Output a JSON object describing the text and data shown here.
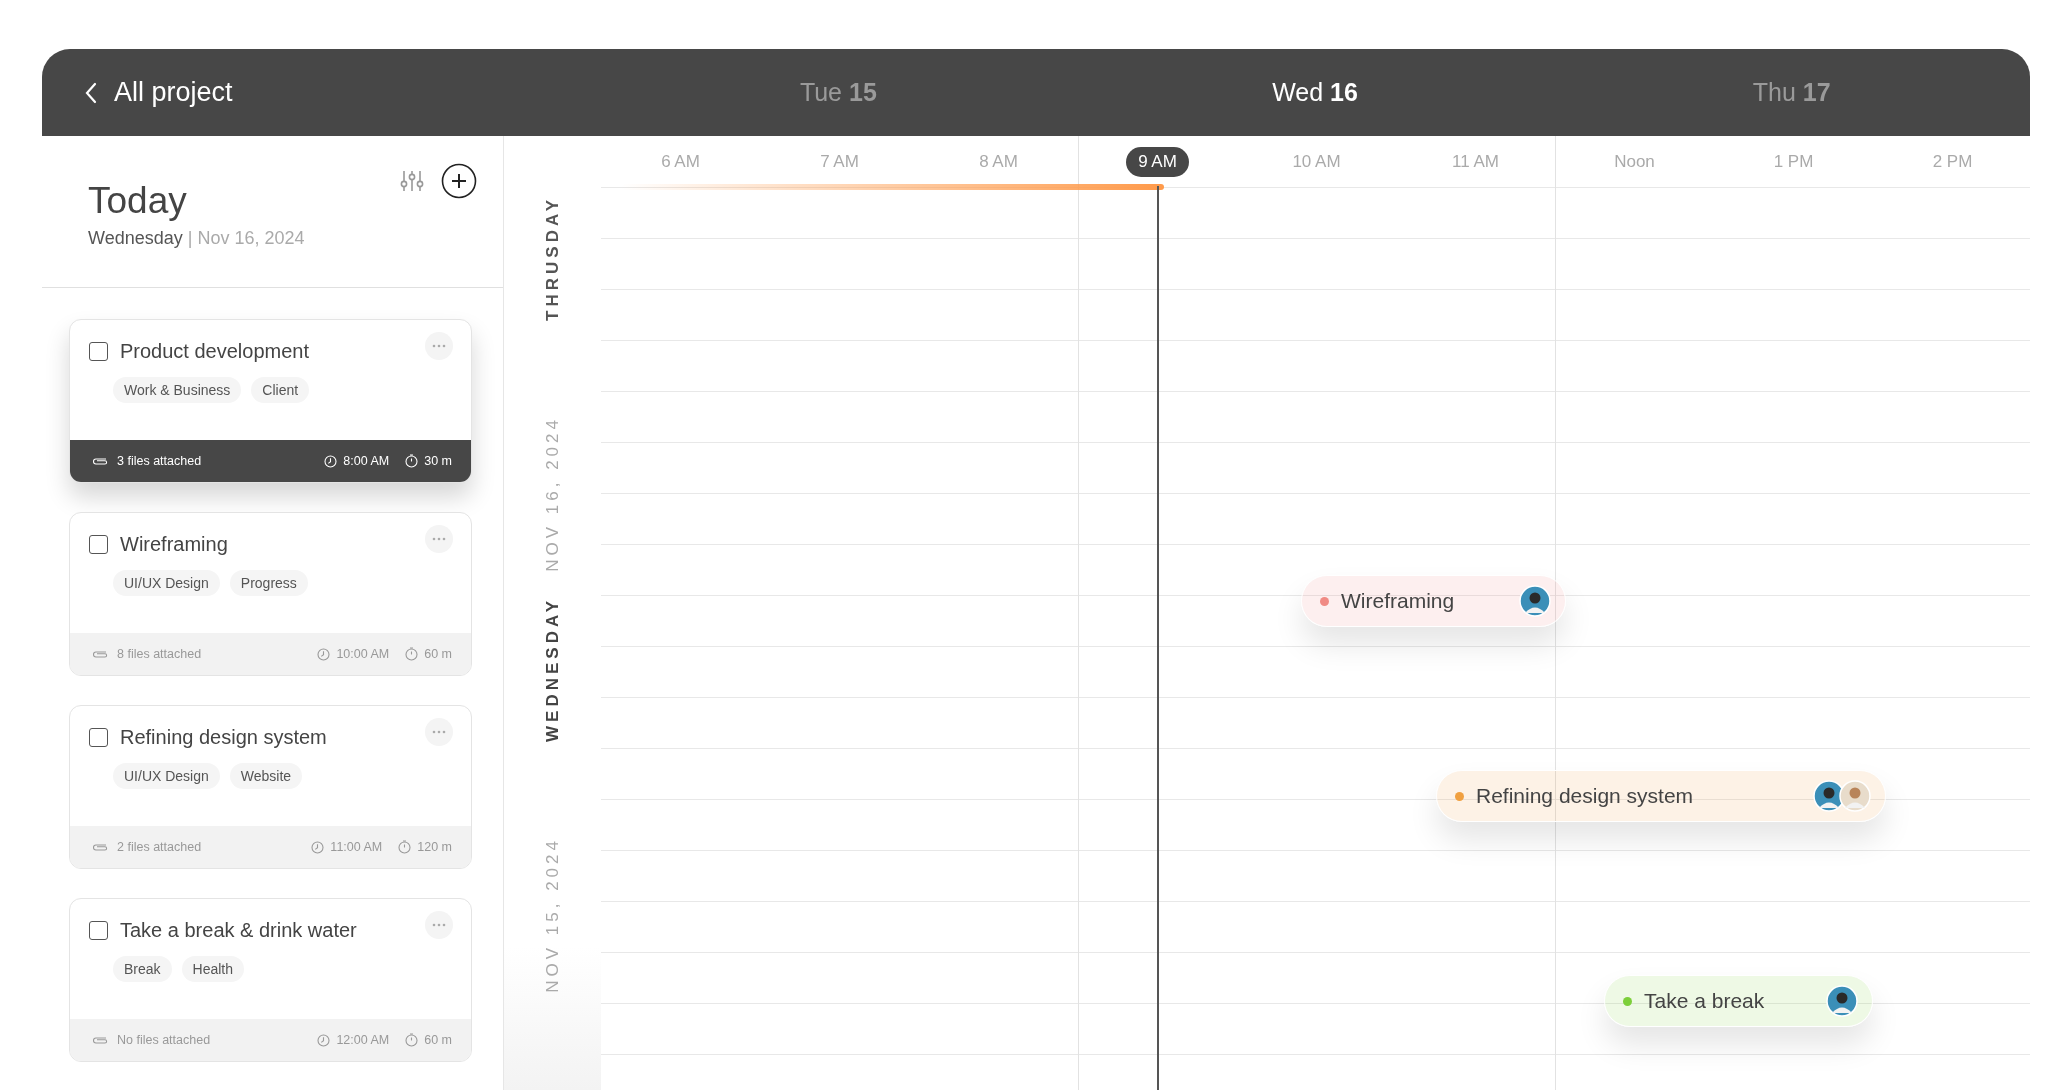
{
  "header": {
    "back_label": "All project",
    "days": [
      {
        "weekday": "Tue",
        "day": "15",
        "selected": false
      },
      {
        "weekday": "Wed",
        "day": "16",
        "selected": true
      },
      {
        "weekday": "Thu",
        "day": "17",
        "selected": false
      }
    ]
  },
  "today": {
    "title": "Today",
    "weekday": "Wednesday",
    "separator": "|",
    "date": "Nov 16, 2024"
  },
  "tasks": [
    {
      "title": "Product development",
      "checked": false,
      "selected": true,
      "tags": [
        "Work & Business",
        "Client"
      ],
      "files": "3 files attached",
      "time": "8:00 AM",
      "duration": "30 m"
    },
    {
      "title": "Wireframing",
      "checked": false,
      "selected": false,
      "tags": [
        "UI/UX Design",
        "Progress"
      ],
      "files": "8 files attached",
      "time": "10:00 AM",
      "duration": "60 m"
    },
    {
      "title": "Refining design system",
      "checked": false,
      "selected": false,
      "tags": [
        "UI/UX Design",
        "Website"
      ],
      "files": "2 files attached",
      "time": "11:00 AM",
      "duration": "120 m"
    },
    {
      "title": "Take a break & drink water",
      "checked": false,
      "selected": false,
      "tags": [
        "Break",
        "Health"
      ],
      "files": "No files attached",
      "time": "12:00 AM",
      "duration": "60 m"
    }
  ],
  "day_labels": [
    {
      "text": "THRUSDAY",
      "kind": "weekday"
    },
    {
      "text": "NOV 16, 2024",
      "kind": "date"
    },
    {
      "text": "WEDNESDAY",
      "kind": "weekday"
    },
    {
      "text": "NOV 15, 2024",
      "kind": "date"
    }
  ],
  "progress": {
    "level": 0.38
  },
  "hours": [
    {
      "label": "6 AM",
      "selected": false
    },
    {
      "label": "7 AM",
      "selected": false
    },
    {
      "label": "8 AM",
      "selected": false
    },
    {
      "label": "9 AM",
      "selected": true
    },
    {
      "label": "10 AM",
      "selected": false
    },
    {
      "label": "11 AM",
      "selected": false
    },
    {
      "label": "Noon",
      "selected": false
    },
    {
      "label": "1 PM",
      "selected": false
    },
    {
      "label": "2 PM",
      "selected": false
    }
  ],
  "events": [
    {
      "title": "Wireframing",
      "color": "#f08a84",
      "avatars": [
        {
          "kind": "man"
        }
      ]
    },
    {
      "title": "Refining design system",
      "color": "#f0a040",
      "avatars": [
        {
          "kind": "man"
        },
        {
          "kind": "woman"
        }
      ]
    },
    {
      "title": "Take a break",
      "color": "#7ccf3a",
      "avatars": [
        {
          "kind": "man"
        }
      ]
    }
  ]
}
